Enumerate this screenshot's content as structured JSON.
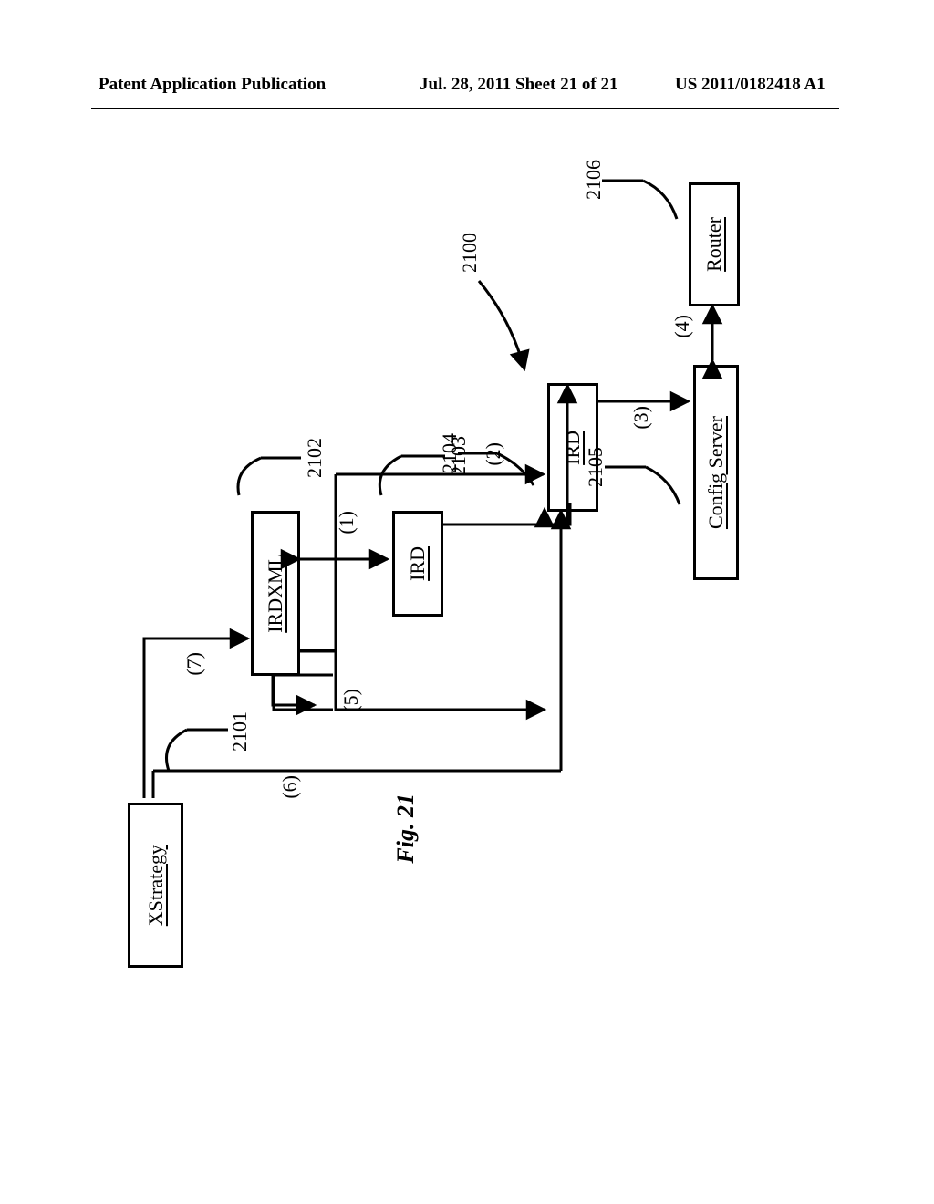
{
  "header": {
    "left": "Patent Application Publication",
    "mid": "Jul. 28, 2011  Sheet 21 of 21",
    "right": "US 2011/0182418 A1"
  },
  "diagram": {
    "ref2100": "2100",
    "ref2101": "2101",
    "ref2102": "2102",
    "ref2103": "2103",
    "ref2104": "2104",
    "ref2105": "2105",
    "ref2106": "2106",
    "boxes": {
      "xstrategy": "XStrategy",
      "irdxml": "IRDXML",
      "ird_a": "IRD",
      "ird_b": "IRD",
      "config_server": "Config Server",
      "router": "Router"
    },
    "edges": {
      "e1": "(1)",
      "e2": "(2)",
      "e3": "(3)",
      "e4": "(4)",
      "e5": "(5)",
      "e6": "(6)",
      "e7": "(7)"
    },
    "figure_caption": "Fig. 21"
  }
}
